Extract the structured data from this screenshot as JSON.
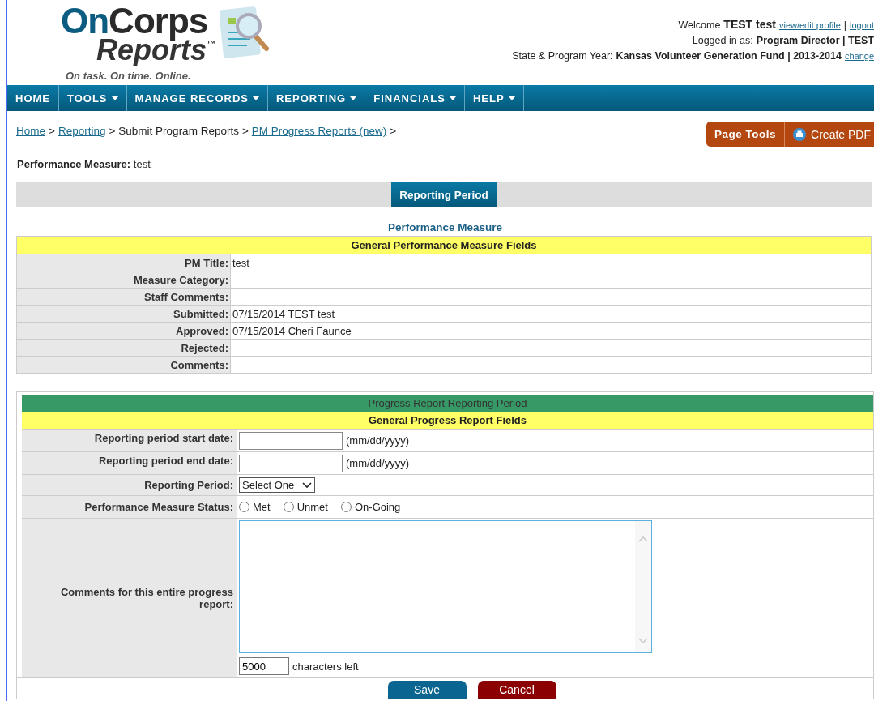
{
  "logo": {
    "word_1": "On",
    "word_2": "Corps",
    "word_3": "Reports",
    "trademark": "™",
    "tagline": "On task. On time. Online."
  },
  "user_info": {
    "welcome": "Welcome",
    "user_name": "TEST test",
    "profile_link": "view/edit profile",
    "separator": "|",
    "logout_link": "logout",
    "logged_in_label": "Logged in as:",
    "logged_in_value": "Program Director | TEST",
    "program_year_label": "State & Program Year:",
    "program_year_value": "Kansas Volunteer Generation Fund | 2013-2014",
    "change_link": "change"
  },
  "nav": [
    {
      "label": "HOME",
      "has_menu": false
    },
    {
      "label": "TOOLS",
      "has_menu": true
    },
    {
      "label": "MANAGE RECORDS",
      "has_menu": true
    },
    {
      "label": "REPORTING",
      "has_menu": true
    },
    {
      "label": "FINANCIALS",
      "has_menu": true
    },
    {
      "label": "HELP",
      "has_menu": true
    }
  ],
  "breadcrumb": [
    {
      "label": "Home",
      "link": true
    },
    {
      "label": "Reporting",
      "link": true
    },
    {
      "label": "Submit Program Reports",
      "link": false
    },
    {
      "label": "PM Progress Reports (new)",
      "link": true
    }
  ],
  "breadcrumb_separator": ">",
  "page_tools": {
    "label": "Page Tools",
    "pdf": "Create PDF"
  },
  "heading": {
    "label": "Performance Measure:",
    "value": "test"
  },
  "tabs": [
    {
      "label": "Reporting Period",
      "selected": true
    }
  ],
  "pm_section": {
    "title": "Performance Measure",
    "subtitle": "General Performance Measure Fields",
    "rows": [
      {
        "label": "PM Title:",
        "value": "test"
      },
      {
        "label": "Measure Category:",
        "value": ""
      },
      {
        "label": "Staff Comments:",
        "value": ""
      },
      {
        "label": "Submitted:",
        "value": "07/15/2014 TEST test"
      },
      {
        "label": "Approved:",
        "value": "07/15/2014 Cheri Faunce"
      },
      {
        "label": "Rejected:",
        "value": ""
      },
      {
        "label": "Comments:",
        "value": ""
      }
    ]
  },
  "progress_section": {
    "title": "Progress Report Reporting Period",
    "subtitle": "General Progress Report Fields",
    "fields": [
      {
        "kind": "date",
        "label": "Reporting period start date:",
        "hint": "(mm/dd/yyyy)"
      },
      {
        "kind": "date",
        "label": "Reporting period end date:",
        "hint": "(mm/dd/yyyy)"
      },
      {
        "kind": "select",
        "label": "Reporting Period:",
        "value": "Select One"
      },
      {
        "kind": "radio",
        "label": "Performance Measure Status:",
        "options": [
          {
            "label": "Met",
            "selected": false
          },
          {
            "label": "Unmet",
            "selected": false
          },
          {
            "label": "On-Going",
            "selected": false
          }
        ]
      },
      {
        "kind": "textarea",
        "label": "Comments for this entire progress report:",
        "counter": "5000",
        "counter_label": "characters left"
      }
    ],
    "buttons": [
      {
        "label": "Save",
        "kind": "primary"
      },
      {
        "label": "Cancel",
        "kind": "danger"
      }
    ]
  }
}
